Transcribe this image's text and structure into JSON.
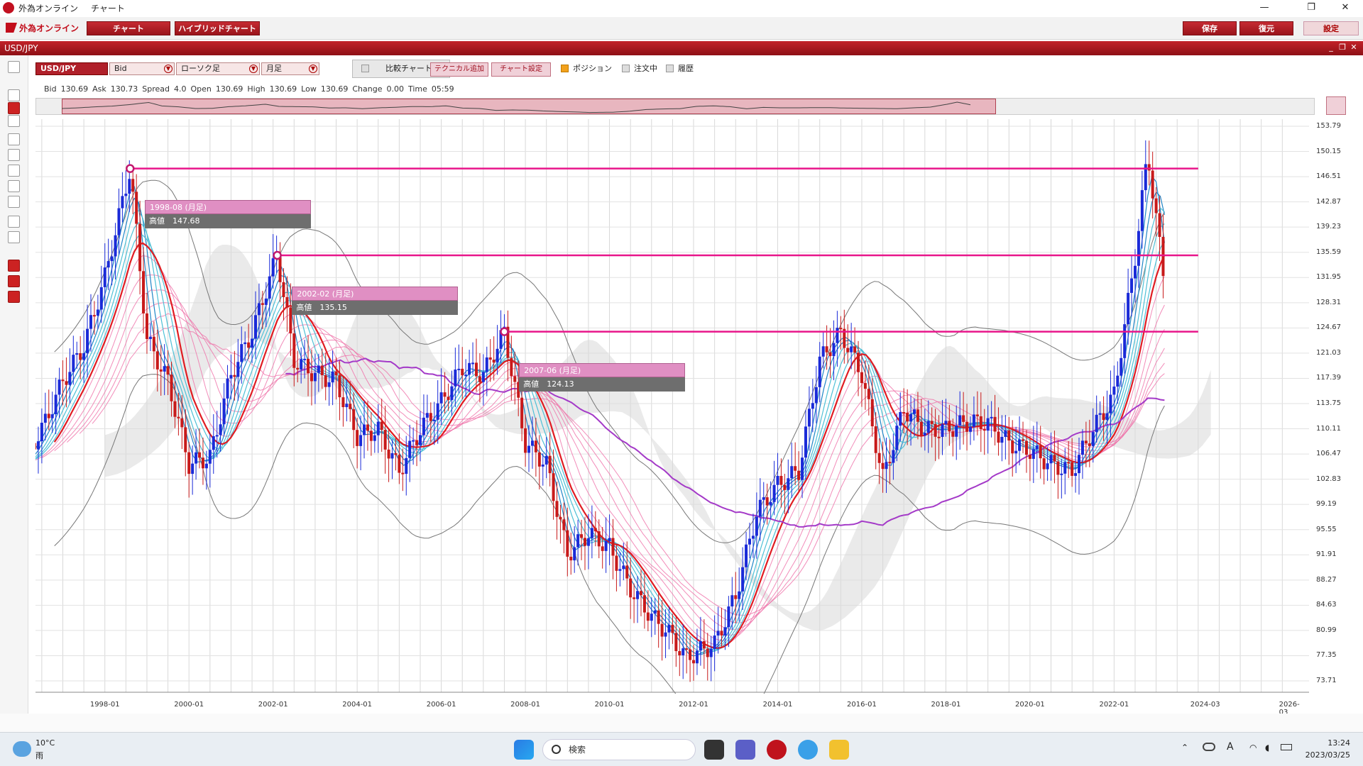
{
  "window": {
    "title": "外為オンライン",
    "subtitle": "チャート",
    "minimize": "—",
    "maximize": "❐",
    "close": "✕"
  },
  "toolbar": {
    "brand": "外為オンライン",
    "chart_btn": "チャート",
    "hybrid_btn": "ハイブリッドチャート",
    "save_btn": "保存",
    "restore_btn": "復元",
    "settings_btn": "設定"
  },
  "header": {
    "symbol": "USD/JPY"
  },
  "controls": {
    "pair": "USD/JPY",
    "price_type": "Bid",
    "chart_type": "ローソク足",
    "period": "月足",
    "compare": "比較チャート",
    "add_tech": "テクニカル追加",
    "chart_settings": "チャート設定",
    "position": "ポジション",
    "orders": "注文中",
    "history": "履歴"
  },
  "quote": {
    "bid_label": "Bid",
    "bid": "130.69",
    "ask_label": "Ask",
    "ask": "130.73",
    "spread_label": "Spread",
    "spread": "4.0",
    "open_label": "Open",
    "open": "130.69",
    "high_label": "High",
    "high": "130.69",
    "low_label": "Low",
    "low": "130.69",
    "change_label": "Change",
    "change": "0.00",
    "time_label": "Time",
    "time": "05:59"
  },
  "chart_data": {
    "type": "line",
    "title": "USD/JPY 月足",
    "y_ticks": [
      "153.79",
      "150.15",
      "146.51",
      "142.87",
      "139.23",
      "135.59",
      "131.95",
      "128.31",
      "124.67",
      "121.03",
      "117.39",
      "113.75",
      "110.11",
      "106.47",
      "102.83",
      "99.19",
      "95.55",
      "91.91",
      "88.27",
      "84.63",
      "80.99",
      "77.35",
      "73.71"
    ],
    "x_ticks": [
      "1998-01",
      "2000-01",
      "2002-01",
      "2004-01",
      "2006-01",
      "2008-01",
      "2010-01",
      "2012-01",
      "2014-01",
      "2016-01",
      "2018-01",
      "2020-01",
      "2022-01",
      "2024-03",
      "2026-03"
    ],
    "ylim": [
      73.71,
      153.79
    ],
    "series": [
      {
        "name": "USD/JPY",
        "x": [
          1996.0,
          1996.5,
          1997.0,
          1997.5,
          1998.0,
          1998.6,
          1999.0,
          1999.5,
          2000.0,
          2000.5,
          2001.0,
          2001.5,
          2002.1,
          2002.5,
          2003.0,
          2003.5,
          2004.0,
          2004.5,
          2005.0,
          2005.5,
          2006.0,
          2006.5,
          2007.0,
          2007.5,
          2008.0,
          2008.5,
          2009.0,
          2009.5,
          2010.0,
          2010.5,
          2011.0,
          2011.5,
          2011.8,
          2012.5,
          2013.0,
          2013.5,
          2014.0,
          2014.5,
          2015.0,
          2015.5,
          2016.0,
          2016.5,
          2017.0,
          2017.5,
          2018.0,
          2018.5,
          2019.0,
          2019.5,
          2020.0,
          2020.5,
          2021.0,
          2021.5,
          2022.0,
          2022.5,
          2022.8,
          2023.2
        ],
        "y": [
          105,
          110,
          117,
          122,
          132,
          147.7,
          123,
          117,
          105,
          106,
          118,
          124,
          135.2,
          120,
          118,
          117,
          109,
          110,
          104,
          110,
          114,
          119,
          118,
          124.1,
          108,
          105,
          92,
          95,
          93,
          87,
          83,
          80,
          77,
          79,
          86,
          98,
          102,
          104,
          120,
          124,
          118,
          103,
          113,
          110,
          110,
          111,
          111,
          108,
          107,
          105,
          104,
          110,
          115,
          135,
          150,
          131
        ]
      }
    ],
    "resistance_levels": [
      147.68,
      135.15,
      124.13
    ],
    "annotations": [
      {
        "label": "1998-08 (月足)",
        "high_label": "高値",
        "value": "147.68"
      },
      {
        "label": "2002-02 (月足)",
        "high_label": "高値",
        "value": "135.15"
      },
      {
        "label": "2007-06 (月足)",
        "high_label": "高値",
        "value": "124.13"
      }
    ],
    "grid": true
  },
  "taskbar": {
    "weather_temp": "10°C",
    "weather_desc": "雨",
    "search": "検索",
    "time": "13:24",
    "date": "2023/03/25",
    "ime": "A"
  },
  "colors": {
    "accent": "#b0202a",
    "candle_up": "#1a2ad8",
    "candle_down": "#c81a1a",
    "ma_red": "#e01c22",
    "ma_purple": "#a43ac8",
    "level": "#e8158a"
  }
}
